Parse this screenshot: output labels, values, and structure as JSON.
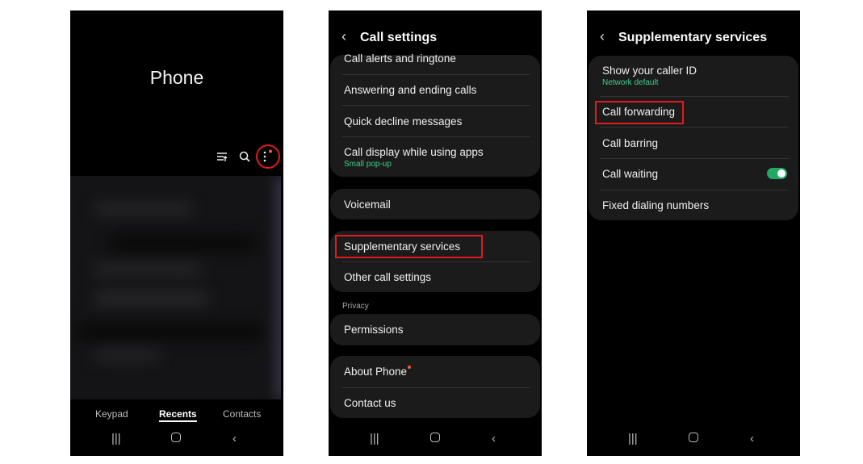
{
  "phone": {
    "title": "Phone",
    "icons": [
      "filter-icon",
      "search-icon",
      "more-options-icon"
    ],
    "tabs": [
      {
        "label": "Keypad"
      },
      {
        "label": "Recents",
        "active": true
      },
      {
        "label": "Contacts"
      }
    ]
  },
  "call_settings": {
    "title": "Call settings",
    "items": [
      {
        "label": "Call alerts and ringtone"
      },
      {
        "label": "Answering and ending calls"
      },
      {
        "label": "Quick decline messages"
      },
      {
        "label": "Call display while using apps",
        "sub": "Small pop-up"
      },
      {
        "label": "Voicemail"
      },
      {
        "label": "Supplementary services"
      },
      {
        "label": "Other call settings"
      },
      {
        "label": "Permissions"
      },
      {
        "label": "About Phone"
      },
      {
        "label": "Contact us"
      }
    ],
    "section_privacy": "Privacy"
  },
  "supplementary": {
    "title": "Supplementary services",
    "items": [
      {
        "label": "Show your caller ID",
        "sub": "Network default"
      },
      {
        "label": "Call forwarding"
      },
      {
        "label": "Call barring"
      },
      {
        "label": "Call waiting",
        "toggle": true
      },
      {
        "label": "Fixed dialing numbers"
      }
    ]
  },
  "nav_icons": [
    "recent-apps-icon",
    "home-icon",
    "back-icon"
  ],
  "colors": {
    "accent_green": "#3ecf8e",
    "toggle_on": "#22a865",
    "highlight": "#e01b1b",
    "badge": "#ff5a36"
  }
}
